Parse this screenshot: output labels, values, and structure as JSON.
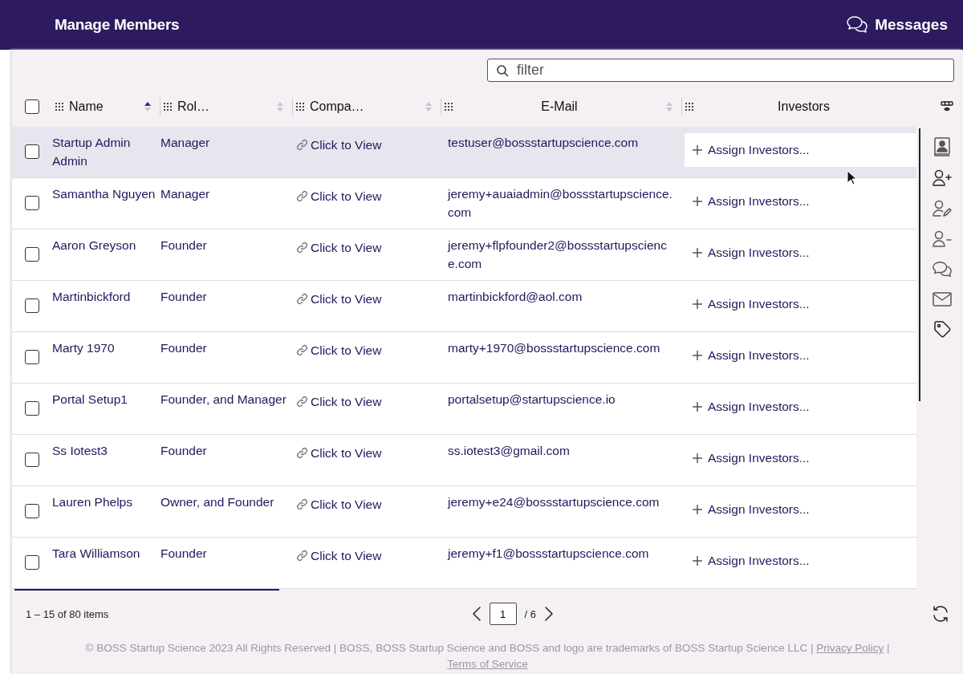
{
  "header": {
    "title": "Manage Members",
    "messages_label": "Messages"
  },
  "filter": {
    "placeholder": "filter"
  },
  "columns": [
    {
      "label": "Name",
      "sortable": true,
      "sorted": true
    },
    {
      "label": "Rol…",
      "sortable": true,
      "sorted": false
    },
    {
      "label": "Compa…",
      "sortable": true,
      "sorted": false
    },
    {
      "label": "E-Mail",
      "sortable": true,
      "sorted": false
    },
    {
      "label": "Investors",
      "sortable": false
    }
  ],
  "header_checkbox": {
    "checked": false
  },
  "rows": [
    {
      "name": "Startup Admin Admin",
      "role": "Manager",
      "company": "Click to View",
      "email": "testuser@bossstartupscience.com",
      "investors": "Assign Investors...",
      "checked": false,
      "highlighted": true
    },
    {
      "name": "Samantha Nguyen",
      "role": "Manager",
      "company": "Click to View",
      "email": "jeremy+auaiadmin@bossstartupscience.com",
      "investors": "Assign Investors...",
      "checked": false,
      "highlighted": false
    },
    {
      "name": "Aaron Greyson",
      "role": "Founder",
      "company": "Click to View",
      "email": "jeremy+flpfounder2@bossstartupscience.com",
      "investors": "Assign Investors...",
      "checked": false,
      "highlighted": false
    },
    {
      "name": "Martinbickford",
      "role": "Founder",
      "company": "Click to View",
      "email": "martinbickford@aol.com",
      "investors": "Assign Investors...",
      "checked": false,
      "highlighted": false
    },
    {
      "name": "Marty 1970",
      "role": "Founder",
      "company": "Click to View",
      "email": "marty+1970@bossstartupscience.com",
      "investors": "Assign Investors...",
      "checked": false,
      "highlighted": false
    },
    {
      "name": "Portal Setup1",
      "role": "Founder, and Manager",
      "company": "Click to View",
      "email": "portalsetup@startupscience.io",
      "investors": "Assign Investors...",
      "checked": false,
      "highlighted": false
    },
    {
      "name": "Ss Iotest3",
      "role": "Founder",
      "company": "Click to View",
      "email": "ss.iotest3@gmail.com",
      "investors": "Assign Investors...",
      "checked": false,
      "highlighted": false
    },
    {
      "name": "Lauren Phelps",
      "role": "Owner, and Founder",
      "company": "Click to View",
      "email": "jeremy+e24@bossstartupscience.com",
      "investors": "Assign Investors...",
      "checked": false,
      "highlighted": false
    },
    {
      "name": "Tara Williamson",
      "role": "Founder",
      "company": "Click to View",
      "email": "jeremy+f1@bossstartupscience.com",
      "investors": "Assign Investors...",
      "checked": false,
      "highlighted": false
    }
  ],
  "pager": {
    "summary": "1 – 15 of 80 items",
    "page": "1",
    "total": "/ 6"
  },
  "footer": {
    "text": "© BOSS Startup Science 2023 All Rights Reserved | BOSS, BOSS Startup Science and BOSS and logo are trademarks of BOSS Startup Science LLC |",
    "links": [
      "Privacy Policy",
      "Terms of Service"
    ],
    "separator": "|"
  }
}
